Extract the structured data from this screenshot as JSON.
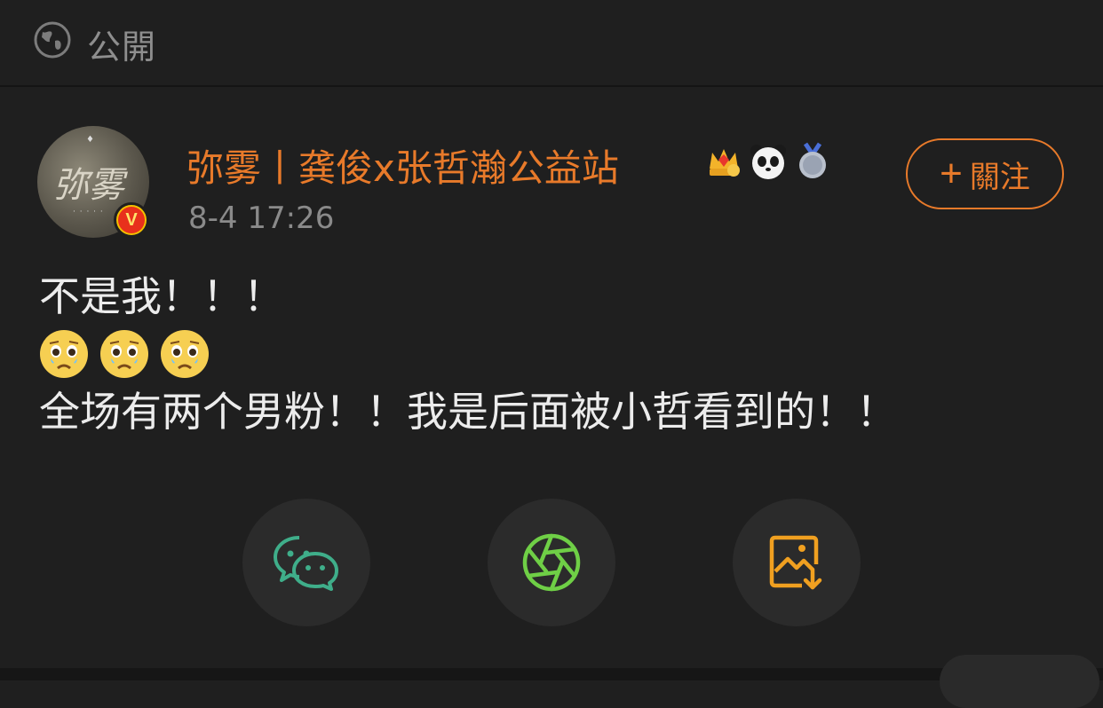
{
  "topbar": {
    "visibility_label": "公開",
    "icon": "globe-icon"
  },
  "post_header": {
    "username": "弥雾丨龚俊x张哲瀚公益站",
    "timestamp": "8-4 17:26",
    "avatar_text": "弥雾",
    "badges": [
      "crown-level-icon",
      "panda-icon",
      "medal-icon"
    ],
    "verified_badge": "V"
  },
  "follow_button": {
    "plus": "+",
    "label": "關注"
  },
  "post_body": {
    "line1": "不是我！！！",
    "emojis": [
      "crying-face-icon",
      "crying-face-icon",
      "crying-face-icon"
    ],
    "line2": "全场有两个男粉！！我是后面被小哲看到的！！"
  },
  "share": {
    "items": [
      "wechat-icon",
      "moments-icon",
      "save-image-icon"
    ]
  },
  "colors": {
    "accent": "#e87a2a",
    "background": "#1f1f1f",
    "wechat": "#3fae8a",
    "moments": "#6fcf46",
    "save": "#f0a020"
  }
}
